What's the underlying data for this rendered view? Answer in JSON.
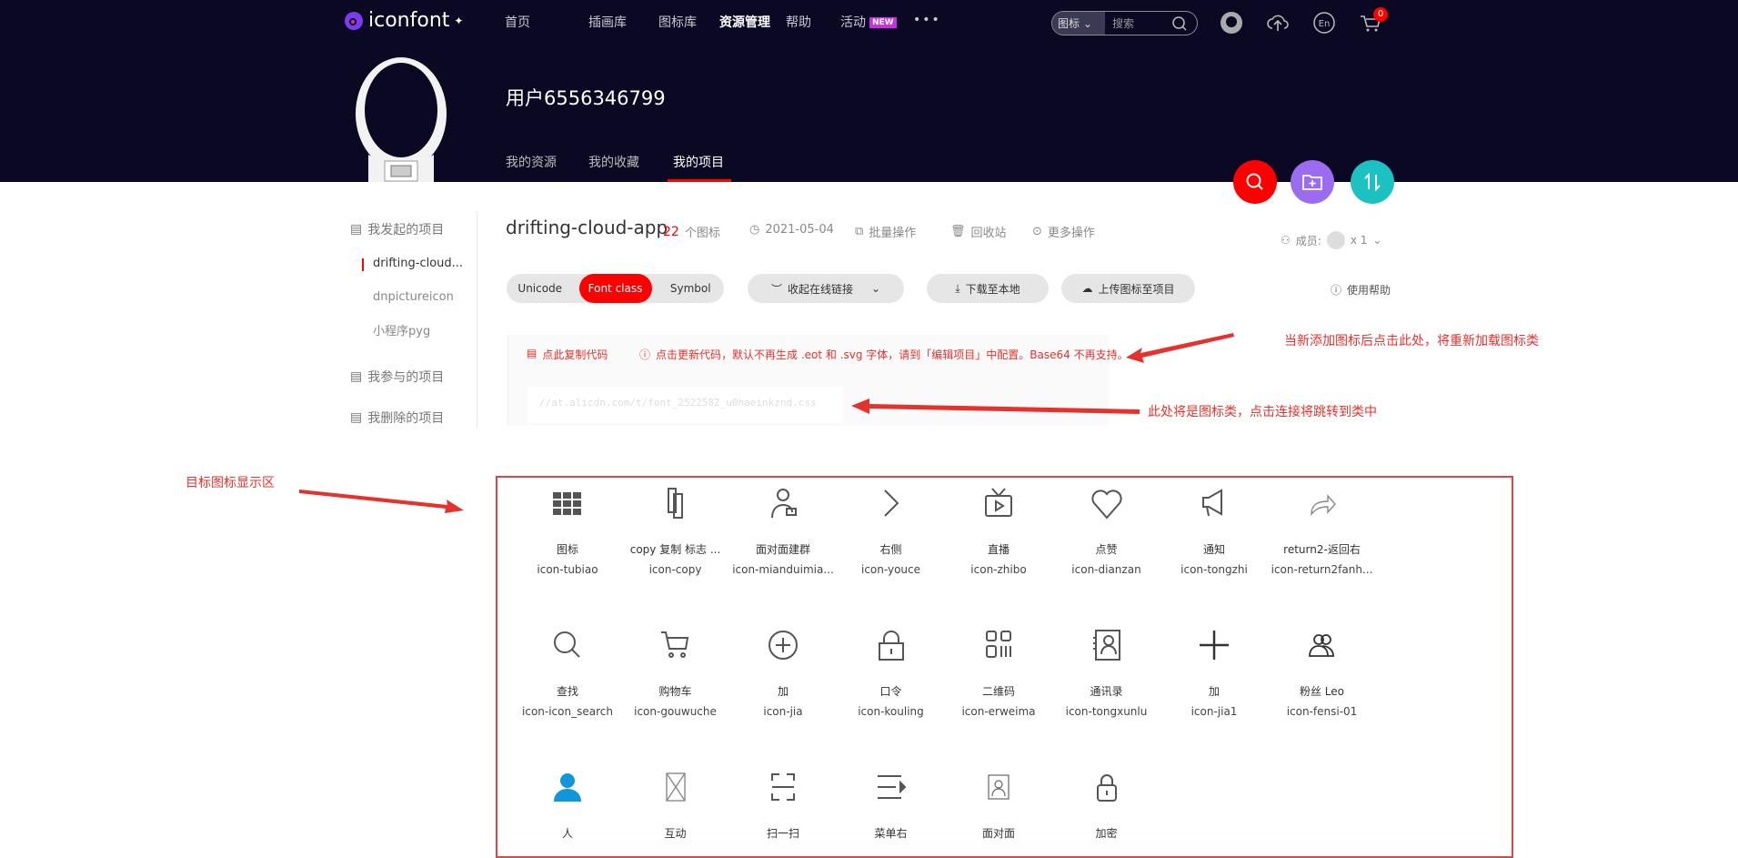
{
  "brand": {
    "logo_text": "iconfont",
    "accent": "#f00000",
    "header_bg": "#0b0823"
  },
  "nav": {
    "items": [
      "首页",
      "插画库",
      "图标库",
      "资源管理",
      "帮助",
      "活动"
    ],
    "active": "资源管理",
    "new_badge": "NEW",
    "more": "•••"
  },
  "search": {
    "type": "图标",
    "placeholder": "搜索"
  },
  "header_icons": [
    "github-icon",
    "upload-cloud-icon",
    "language-en-icon",
    "cart-icon"
  ],
  "cart_count": "0",
  "language": "En",
  "user": {
    "name": "用户6556346799"
  },
  "profile_tabs": [
    "我的资源",
    "我的收藏",
    "我的项目"
  ],
  "profile_tab_active": "我的项目",
  "fabs": [
    {
      "icon": "search-icon",
      "color": "#f00000"
    },
    {
      "icon": "add-folder-icon",
      "color": "#9b6cf0"
    },
    {
      "icon": "sort-icon",
      "color": "#1cc1c1"
    }
  ],
  "sidebar": {
    "started": "我发起的项目",
    "projects": [
      "drifting-cloud...",
      "dnpictureicon",
      "小程序pyg"
    ],
    "active_project": "drifting-cloud...",
    "joined": "我参与的项目",
    "deleted": "我删除的项目"
  },
  "project": {
    "name": "drifting-cloud-app",
    "icon_count": "22",
    "icon_count_unit": "个图标",
    "date": "2021-05-04",
    "batch": "批量操作",
    "recycle": "回收站",
    "more": "更多操作",
    "members_label": "成员:",
    "members_count": "x 1"
  },
  "toolbar": {
    "modes": [
      "Unicode",
      "Font class",
      "Symbol"
    ],
    "active_mode": "Font class",
    "collapse_link": "收起在线链接",
    "download": "下载至本地",
    "upload": "上传图标至项目",
    "help": "使用帮助"
  },
  "code": {
    "copy": "点此复制代码",
    "notice": "点击更新代码，默认不再生成 .eot 和 .svg 字体，请到「编辑项目」中配置。Base64 不再支持。",
    "url": "//at.alicdn.com/t/font_2522582_u0haeinkznd.css"
  },
  "annotations": {
    "refresh": "当新添加图标后点击此处，将重新加载图标类",
    "class": "此处将是图标类，点击连接将跳转到类中",
    "area": "目标图标显示区"
  },
  "icons": [
    {
      "name": "图标",
      "class": "icon-tubiao",
      "glyph": "grid"
    },
    {
      "name": "copy 复制 标志 ...",
      "class": "icon-copy",
      "glyph": "copy"
    },
    {
      "name": "面对面建群",
      "class": "icon-mianduimia...",
      "glyph": "person-card"
    },
    {
      "name": "右侧",
      "class": "icon-youce",
      "glyph": "chevron-right"
    },
    {
      "name": "直播",
      "class": "icon-zhibo",
      "glyph": "tv"
    },
    {
      "name": "点赞",
      "class": "icon-dianzan",
      "glyph": "heart"
    },
    {
      "name": "通知",
      "class": "icon-tongzhi",
      "glyph": "megaphone"
    },
    {
      "name": "return2-返回右",
      "class": "icon-return2fanh...",
      "glyph": "share"
    },
    {
      "name": "查找",
      "class": "icon-icon_search",
      "glyph": "search"
    },
    {
      "name": "购物车",
      "class": "icon-gouwuche",
      "glyph": "cart"
    },
    {
      "name": "加",
      "class": "icon-jia",
      "glyph": "plus-circle"
    },
    {
      "name": "口令",
      "class": "icon-kouling",
      "glyph": "lock"
    },
    {
      "name": "二维码",
      "class": "icon-erweima",
      "glyph": "qr"
    },
    {
      "name": "通讯录",
      "class": "icon-tongxunlu",
      "glyph": "contacts"
    },
    {
      "name": "加",
      "class": "icon-jia1",
      "glyph": "plus"
    },
    {
      "name": "粉丝 Leo",
      "class": "icon-fensi-01",
      "glyph": "users"
    },
    {
      "name": "人",
      "class": "",
      "glyph": "user"
    },
    {
      "name": "互动",
      "class": "",
      "glyph": "interact"
    },
    {
      "name": "扫一扫",
      "class": "",
      "glyph": "scan"
    },
    {
      "name": "菜单右",
      "class": "",
      "glyph": "menu-right"
    },
    {
      "name": "面对面",
      "class": "",
      "glyph": "photo-person"
    },
    {
      "name": "加密",
      "class": "",
      "glyph": "lock-small"
    }
  ]
}
